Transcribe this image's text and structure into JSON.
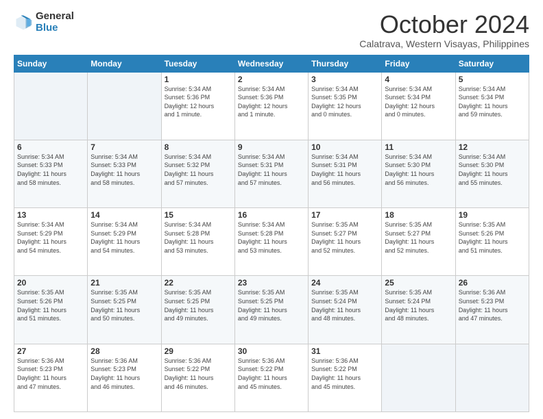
{
  "logo": {
    "general": "General",
    "blue": "Blue"
  },
  "header": {
    "month": "October 2024",
    "location": "Calatrava, Western Visayas, Philippines"
  },
  "days_of_week": [
    "Sunday",
    "Monday",
    "Tuesday",
    "Wednesday",
    "Thursday",
    "Friday",
    "Saturday"
  ],
  "weeks": [
    [
      {
        "day": "",
        "info": ""
      },
      {
        "day": "",
        "info": ""
      },
      {
        "day": "1",
        "info": "Sunrise: 5:34 AM\nSunset: 5:36 PM\nDaylight: 12 hours\nand 1 minute."
      },
      {
        "day": "2",
        "info": "Sunrise: 5:34 AM\nSunset: 5:36 PM\nDaylight: 12 hours\nand 1 minute."
      },
      {
        "day": "3",
        "info": "Sunrise: 5:34 AM\nSunset: 5:35 PM\nDaylight: 12 hours\nand 0 minutes."
      },
      {
        "day": "4",
        "info": "Sunrise: 5:34 AM\nSunset: 5:34 PM\nDaylight: 12 hours\nand 0 minutes."
      },
      {
        "day": "5",
        "info": "Sunrise: 5:34 AM\nSunset: 5:34 PM\nDaylight: 11 hours\nand 59 minutes."
      }
    ],
    [
      {
        "day": "6",
        "info": "Sunrise: 5:34 AM\nSunset: 5:33 PM\nDaylight: 11 hours\nand 58 minutes."
      },
      {
        "day": "7",
        "info": "Sunrise: 5:34 AM\nSunset: 5:33 PM\nDaylight: 11 hours\nand 58 minutes."
      },
      {
        "day": "8",
        "info": "Sunrise: 5:34 AM\nSunset: 5:32 PM\nDaylight: 11 hours\nand 57 minutes."
      },
      {
        "day": "9",
        "info": "Sunrise: 5:34 AM\nSunset: 5:31 PM\nDaylight: 11 hours\nand 57 minutes."
      },
      {
        "day": "10",
        "info": "Sunrise: 5:34 AM\nSunset: 5:31 PM\nDaylight: 11 hours\nand 56 minutes."
      },
      {
        "day": "11",
        "info": "Sunrise: 5:34 AM\nSunset: 5:30 PM\nDaylight: 11 hours\nand 56 minutes."
      },
      {
        "day": "12",
        "info": "Sunrise: 5:34 AM\nSunset: 5:30 PM\nDaylight: 11 hours\nand 55 minutes."
      }
    ],
    [
      {
        "day": "13",
        "info": "Sunrise: 5:34 AM\nSunset: 5:29 PM\nDaylight: 11 hours\nand 54 minutes."
      },
      {
        "day": "14",
        "info": "Sunrise: 5:34 AM\nSunset: 5:29 PM\nDaylight: 11 hours\nand 54 minutes."
      },
      {
        "day": "15",
        "info": "Sunrise: 5:34 AM\nSunset: 5:28 PM\nDaylight: 11 hours\nand 53 minutes."
      },
      {
        "day": "16",
        "info": "Sunrise: 5:34 AM\nSunset: 5:28 PM\nDaylight: 11 hours\nand 53 minutes."
      },
      {
        "day": "17",
        "info": "Sunrise: 5:35 AM\nSunset: 5:27 PM\nDaylight: 11 hours\nand 52 minutes."
      },
      {
        "day": "18",
        "info": "Sunrise: 5:35 AM\nSunset: 5:27 PM\nDaylight: 11 hours\nand 52 minutes."
      },
      {
        "day": "19",
        "info": "Sunrise: 5:35 AM\nSunset: 5:26 PM\nDaylight: 11 hours\nand 51 minutes."
      }
    ],
    [
      {
        "day": "20",
        "info": "Sunrise: 5:35 AM\nSunset: 5:26 PM\nDaylight: 11 hours\nand 51 minutes."
      },
      {
        "day": "21",
        "info": "Sunrise: 5:35 AM\nSunset: 5:25 PM\nDaylight: 11 hours\nand 50 minutes."
      },
      {
        "day": "22",
        "info": "Sunrise: 5:35 AM\nSunset: 5:25 PM\nDaylight: 11 hours\nand 49 minutes."
      },
      {
        "day": "23",
        "info": "Sunrise: 5:35 AM\nSunset: 5:25 PM\nDaylight: 11 hours\nand 49 minutes."
      },
      {
        "day": "24",
        "info": "Sunrise: 5:35 AM\nSunset: 5:24 PM\nDaylight: 11 hours\nand 48 minutes."
      },
      {
        "day": "25",
        "info": "Sunrise: 5:35 AM\nSunset: 5:24 PM\nDaylight: 11 hours\nand 48 minutes."
      },
      {
        "day": "26",
        "info": "Sunrise: 5:36 AM\nSunset: 5:23 PM\nDaylight: 11 hours\nand 47 minutes."
      }
    ],
    [
      {
        "day": "27",
        "info": "Sunrise: 5:36 AM\nSunset: 5:23 PM\nDaylight: 11 hours\nand 47 minutes."
      },
      {
        "day": "28",
        "info": "Sunrise: 5:36 AM\nSunset: 5:23 PM\nDaylight: 11 hours\nand 46 minutes."
      },
      {
        "day": "29",
        "info": "Sunrise: 5:36 AM\nSunset: 5:22 PM\nDaylight: 11 hours\nand 46 minutes."
      },
      {
        "day": "30",
        "info": "Sunrise: 5:36 AM\nSunset: 5:22 PM\nDaylight: 11 hours\nand 45 minutes."
      },
      {
        "day": "31",
        "info": "Sunrise: 5:36 AM\nSunset: 5:22 PM\nDaylight: 11 hours\nand 45 minutes."
      },
      {
        "day": "",
        "info": ""
      },
      {
        "day": "",
        "info": ""
      }
    ]
  ]
}
